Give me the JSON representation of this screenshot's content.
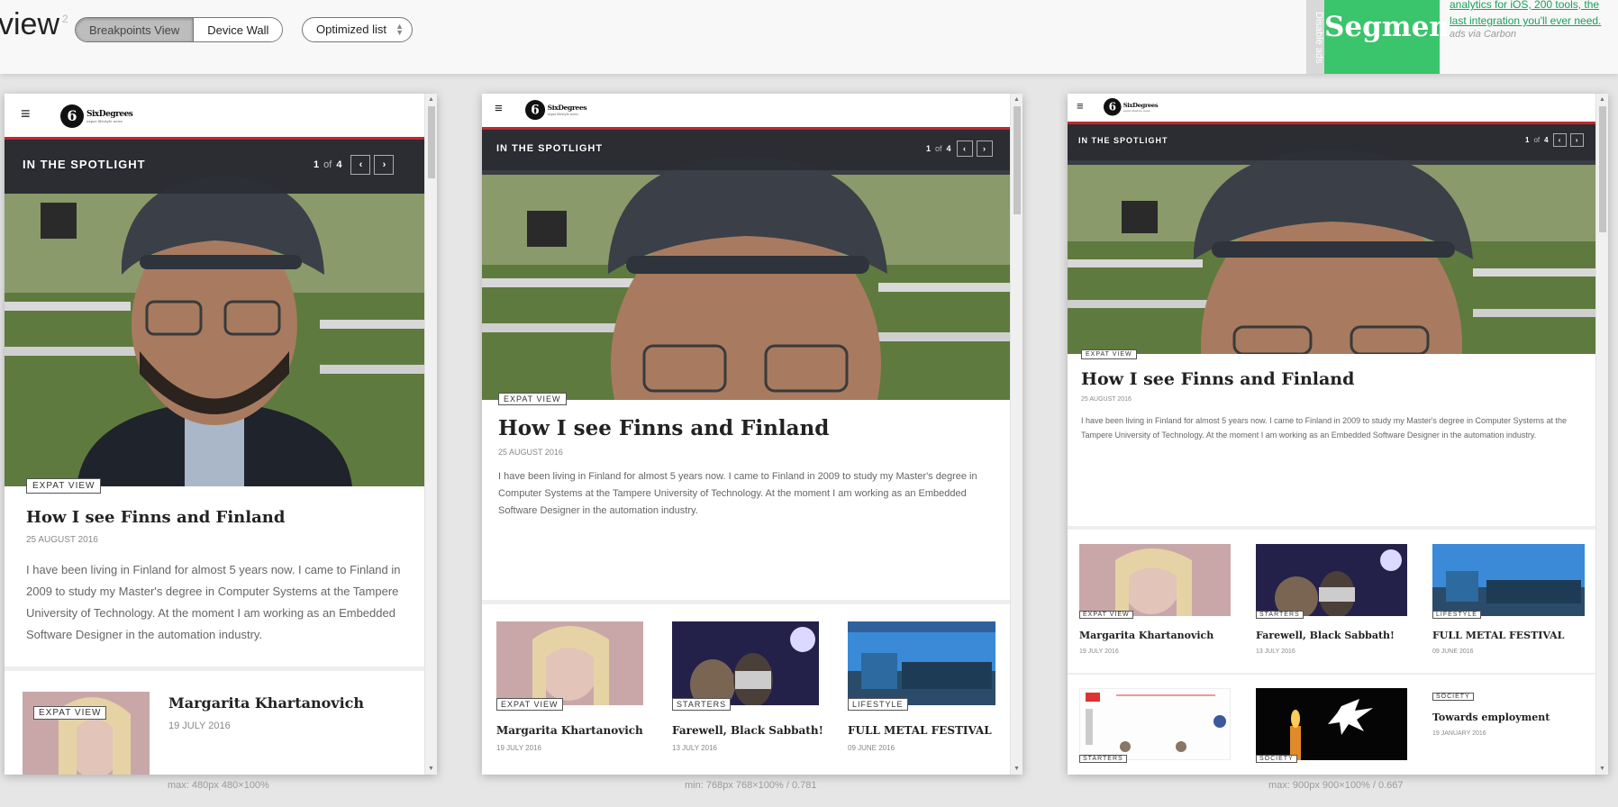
{
  "toolbar": {
    "title": "view",
    "title_sup": "2",
    "breakpoints_label": "Breakpoints View",
    "device_wall_label": "Device Wall",
    "list_select_value": "Optimized list"
  },
  "ad": {
    "disable_label": "Disable ads",
    "logo_text": "Segment",
    "text": "analytics for iOS, 200 tools, the last integration you'll ever need.",
    "via": "ads via Carbon"
  },
  "site": {
    "logo_text": "SixDegrees",
    "logo_tag": "expat lifestyle news",
    "spotlight_label": "IN THE SPOTLIGHT",
    "pager": {
      "current": "1",
      "of": "of",
      "total": "4"
    },
    "featured": {
      "category": "EXPAT VIEW",
      "title": "How I see Finns and Finland",
      "date": "25 AUGUST 2016",
      "excerpt": "I have been living in Finland for almost 5 years now. I came to Finland in 2009 to study my Master's degree in Computer Systems at the Tampere University of Technology. At the moment I am working as an Embedded Software Designer in the automation industry."
    },
    "articles": [
      {
        "category": "EXPAT VIEW",
        "title": "Margarita Khartanovich",
        "date": "19 JULY 2016"
      },
      {
        "category": "STARTERS",
        "title": "Farewell, Black Sabbath!",
        "date": "13 JULY 2016"
      },
      {
        "category": "LIFESTYLE",
        "title": "FULL METAL FESTIVAL",
        "date": "09 JUNE 2016"
      },
      {
        "category": "STARTERS",
        "title": "",
        "date": ""
      },
      {
        "category": "SOCIETY",
        "title": "",
        "date": ""
      },
      {
        "category": "SOCIETY",
        "title": "Towards employment",
        "date": "19 JANUARY 2016"
      }
    ]
  },
  "frames": [
    {
      "label": "max: 480px   480×100%"
    },
    {
      "label": "min: 768px   768×100% / 0.781"
    },
    {
      "label": "max: 900px   900×100% / 0.667"
    }
  ],
  "colors": {
    "accent": "#c4262e",
    "ad_green": "#3ac46b"
  }
}
